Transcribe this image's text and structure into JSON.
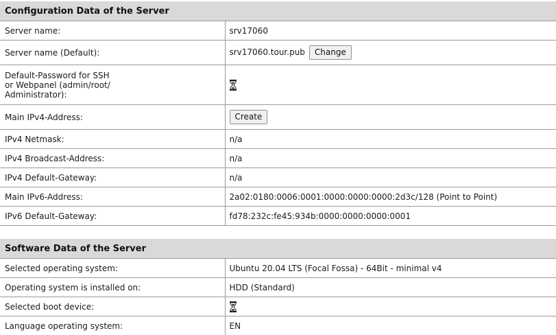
{
  "config_section": {
    "title": "Configuration Data of the Server",
    "rows": {
      "server_name": {
        "label": "Server name:",
        "value": "srv17060"
      },
      "server_name_default": {
        "label": "Server name (Default):",
        "value": "srv17060.tour.pub",
        "button": "Change"
      },
      "default_password": {
        "label_lines": [
          "Default-Password for SSH",
          "or Webpanel (admin/root/",
          "Administrator):"
        ],
        "icon": "hourglass-icon"
      },
      "main_ipv4": {
        "label": "Main IPv4-Address:",
        "button": "Create"
      },
      "ipv4_netmask": {
        "label": "IPv4 Netmask:",
        "value": "n/a"
      },
      "ipv4_broadcast": {
        "label": "IPv4 Broadcast-Address:",
        "value": "n/a"
      },
      "ipv4_gateway": {
        "label": "IPv4 Default-Gateway:",
        "value": "n/a"
      },
      "main_ipv6": {
        "label": "Main IPv6-Address:",
        "value": "2a02:0180:0006:0001:0000:0000:0000:2d3c/128 (Point to Point)"
      },
      "ipv6_gateway": {
        "label": "IPv6 Default-Gateway:",
        "value": "fd78:232c:fe45:934b:0000:0000:0000:0001"
      }
    }
  },
  "software_section": {
    "title": "Software Data of the Server",
    "rows": {
      "operating_system": {
        "label": "Selected operating system:",
        "value": "Ubuntu 20.04 LTS (Focal Fossa) - 64Bit - minimal v4"
      },
      "installed_on": {
        "label": "Operating system is installed on:",
        "value": "HDD (Standard)"
      },
      "boot_device": {
        "label": "Selected boot device:",
        "icon": "hourglass-icon"
      },
      "language": {
        "label": "Language operating system:",
        "value": "EN"
      }
    }
  },
  "colors": {
    "header_background": "#d9d9d9",
    "border": "#9a9a9a",
    "button_background": "#f0f0f0"
  }
}
